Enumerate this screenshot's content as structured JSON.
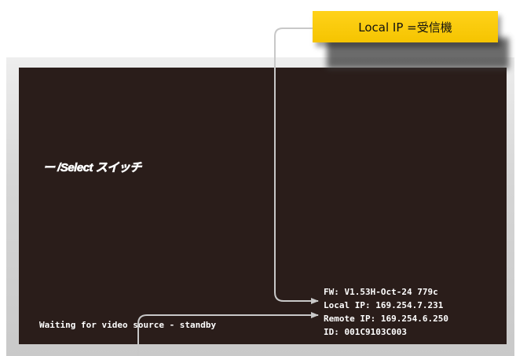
{
  "callout": {
    "label": "Local IP =受信機"
  },
  "screen": {
    "menu_label": "ー /Select スイッチ",
    "waiting_message": "Waiting for video source - standby",
    "info": {
      "fw": "FW: V1.53H-Oct-24 779c",
      "local_ip": "Local IP: 169.254.7.231",
      "remote_ip": "Remote IP: 169.254.6.250",
      "id": "ID: 001C9103C003"
    }
  },
  "colors": {
    "screen_background": "#2a1d1a",
    "callout_background": "#f5c400",
    "leader_line": "#c8c8c8",
    "osd_text": "#ffffff"
  }
}
